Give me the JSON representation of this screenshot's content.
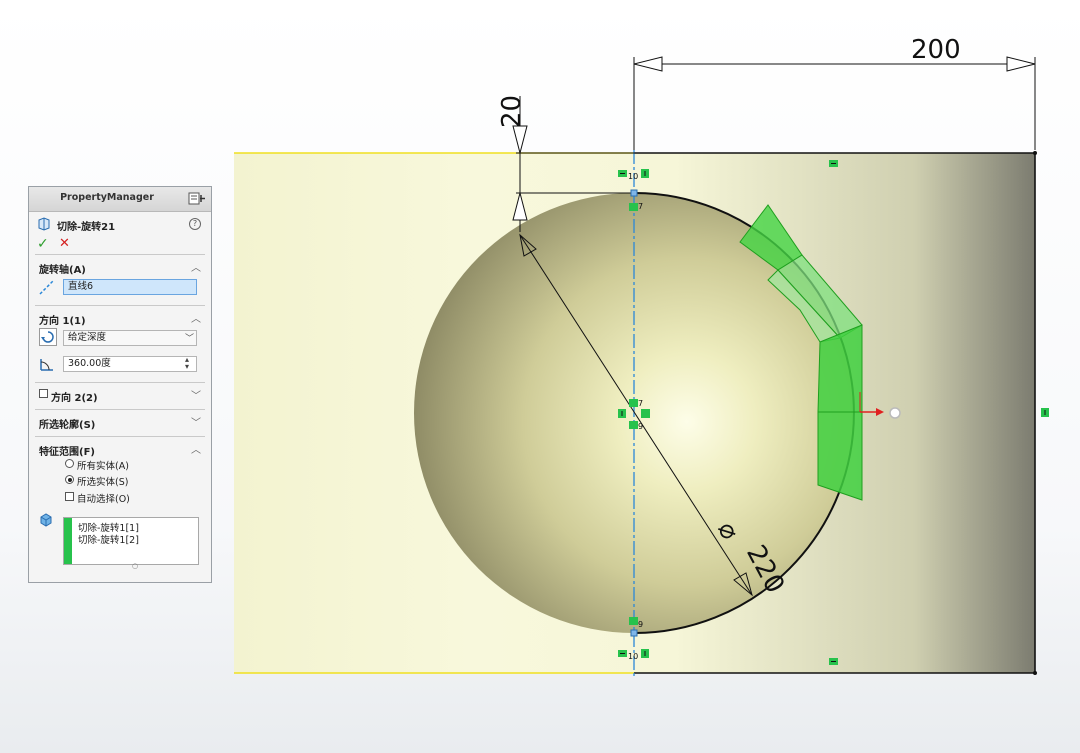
{
  "property_manager": {
    "header_title": "PropertyManager",
    "feature_title": "切除-旋转21",
    "help_glyph": "?",
    "ok_glyph": "✓",
    "cancel_glyph": "✕",
    "rotation_axis": {
      "title": "旋转轴(A)",
      "value": "直线6"
    },
    "direction1": {
      "title": "方向 1(1)",
      "end_condition": "给定深度",
      "angle": "360.00度"
    },
    "direction2": {
      "title": "方向 2(2)"
    },
    "selected_contours": {
      "title": "所选轮廓(S)"
    },
    "feature_scope": {
      "title": "特征范围(F)",
      "options": [
        "所有实体(A)",
        "所选实体(S)",
        "自动选择(O)"
      ],
      "selected_option": "所选实体(S)",
      "bodies": [
        "切除-旋转1[1]",
        "切除-旋转1[2]"
      ]
    }
  },
  "viewport": {
    "dimensions": {
      "width": "200",
      "offset": "20",
      "diameter": "220",
      "diameter_symbol": "⌀"
    },
    "relation_numbers": {
      "top_a": "10",
      "top_b": "7",
      "mid_a": "7",
      "mid_b": "9",
      "bottom_a": "9",
      "bottom_b": "10"
    },
    "colors": {
      "part_yellow": "#f2f2c8",
      "sphere": "#c9c58f",
      "green_feature": "#3cd23c",
      "centerline": "#2b88d8",
      "sketch_line": "#111111"
    }
  }
}
